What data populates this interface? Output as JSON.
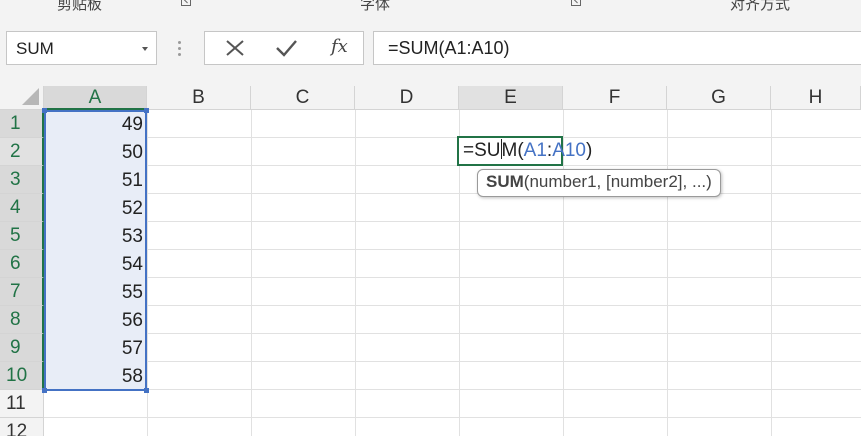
{
  "ribbon": {
    "groups": [
      "剪贴板",
      "字体",
      "对齐方式"
    ]
  },
  "formula_bar": {
    "name_box": "SUM",
    "cancel_icon": "close-icon",
    "enter_icon": "check-icon",
    "function_label": "fx",
    "formula": "=SUM(A1:A10)"
  },
  "sheet": {
    "columns": [
      "A",
      "B",
      "C",
      "D",
      "E",
      "F",
      "G",
      "H"
    ],
    "rows": [
      "1",
      "2",
      "3",
      "4",
      "5",
      "6",
      "7",
      "8",
      "9",
      "10",
      "11",
      "12"
    ],
    "column_a_values": [
      "49",
      "50",
      "51",
      "52",
      "53",
      "54",
      "55",
      "56",
      "57",
      "58"
    ],
    "active_cell": "E2",
    "edit": {
      "prefix": "=SU",
      "suffix": "M(",
      "ref_start": "A1",
      "colon": ":",
      "ref_end": "A10",
      "close": ")"
    },
    "tooltip": {
      "fn": "SUM",
      "args": "(number1, [number2], ...)"
    }
  },
  "colors": {
    "selection_fill": "#e8edf7",
    "selection_border": "#4472c4",
    "active_border": "#217346"
  }
}
